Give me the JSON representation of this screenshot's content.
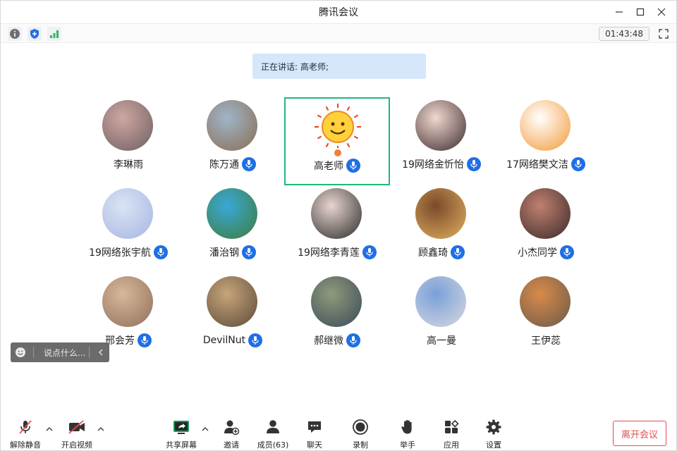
{
  "window": {
    "title": "腾讯会议"
  },
  "infobar": {
    "timer": "01:43:48"
  },
  "speaking": {
    "label": "正在讲话: 高老师;"
  },
  "participants": [
    {
      "name": "李琳雨",
      "mic": false,
      "avatar_colors": [
        "#cfa7a0",
        "#6b5f63"
      ]
    },
    {
      "name": "陈万通",
      "mic": true,
      "avatar_colors": [
        "#9fb5c9",
        "#8a6d52"
      ]
    },
    {
      "name": "高老师",
      "mic": true,
      "active": true,
      "host": true,
      "avatar_colors": [
        "#ffd23b",
        "#f28a1c"
      ]
    },
    {
      "name": "19网络金忻怡",
      "mic": true,
      "avatar_colors": [
        "#f1d7cf",
        "#3b2c2c"
      ]
    },
    {
      "name": "17网络樊文洁",
      "mic": true,
      "avatar_colors": [
        "#ffffff",
        "#f29a3a"
      ]
    },
    {
      "name": "19网络张宇航",
      "mic": true,
      "avatar_colors": [
        "#d9e4f5",
        "#a8b5e0"
      ]
    },
    {
      "name": "潘治钢",
      "mic": true,
      "avatar_colors": [
        "#3aa8d8",
        "#3e7d3a"
      ]
    },
    {
      "name": "19网络李青莲",
      "mic": true,
      "avatar_colors": [
        "#e8d5cf",
        "#2a2a2a"
      ]
    },
    {
      "name": "顾鑫琦",
      "mic": true,
      "avatar_colors": [
        "#7a4a2a",
        "#e0b060"
      ]
    },
    {
      "name": "小杰同学",
      "mic": true,
      "avatar_colors": [
        "#c08070",
        "#3a2a2a"
      ]
    },
    {
      "name": "邢会芳",
      "mic": true,
      "avatar_colors": [
        "#d8b89a",
        "#8f6f5a"
      ]
    },
    {
      "name": "DevilNut",
      "mic": true,
      "avatar_colors": [
        "#c7a57a",
        "#5b4a3a"
      ]
    },
    {
      "name": "郝继微",
      "mic": true,
      "avatar_colors": [
        "#8f9a7a",
        "#3a4a5a"
      ]
    },
    {
      "name": "高一曼",
      "mic": false,
      "avatar_colors": [
        "#7aa0d8",
        "#d8d8e0"
      ]
    },
    {
      "name": "王伊蕊",
      "mic": false,
      "avatar_colors": [
        "#d88a4a",
        "#6a5a4a"
      ]
    }
  ],
  "quick_chat": {
    "placeholder": "说点什么..."
  },
  "toolbar": {
    "unmute": "解除静音",
    "start_video": "开启视频",
    "share_screen": "共享屏幕",
    "invite": "邀请",
    "members": "成员(63)",
    "chat": "聊天",
    "record": "录制",
    "raise_hand": "举手",
    "apps": "应用",
    "settings": "设置",
    "leave": "离开会议"
  },
  "colors": {
    "accent": "#1f6fe5",
    "active_border": "#1fb87a",
    "leave": "#e0504c",
    "banner": "#d6e6fb"
  }
}
